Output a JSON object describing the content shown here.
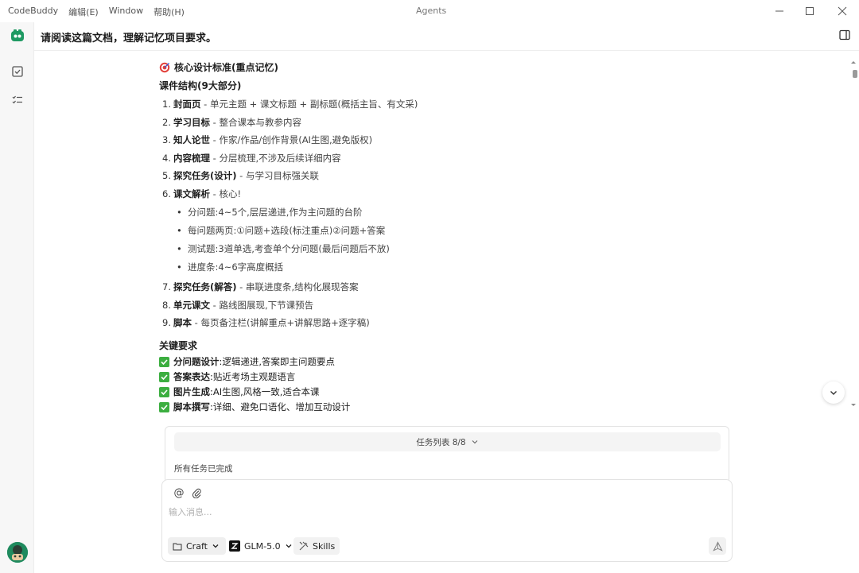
{
  "titlebar": {
    "menu": [
      "CodeBuddy",
      "编辑(E)",
      "Window",
      "帮助(H)"
    ],
    "window_title": "Agents"
  },
  "header": {
    "title": "请阅读这篇文档，理解记忆项目要求。"
  },
  "content": {
    "heading": "核心设计标准(重点记忆)",
    "structure_title": "课件结构(9大部分)",
    "items": [
      {
        "num": "1.",
        "title": "封面页",
        "desc": " - 单元主题 + 课文标题 + 副标题(概括主旨、有文采)"
      },
      {
        "num": "2.",
        "title": "学习目标",
        "desc": " - 整合课本与教参内容"
      },
      {
        "num": "3.",
        "title": "知人论世",
        "desc": " - 作家/作品/创作背景(AI生图,避免版权)"
      },
      {
        "num": "4.",
        "title": "内容梳理",
        "desc": " - 分层梳理,不涉及后续详细内容"
      },
      {
        "num": "5.",
        "title": "探究任务(设计)",
        "desc": " - 与学习目标强关联"
      },
      {
        "num": "6.",
        "title": "课文解析",
        "desc": " - 核心!"
      },
      {
        "num": "7.",
        "title": "探究任务(解答)",
        "desc": " - 串联进度条,结构化展现答案"
      },
      {
        "num": "8.",
        "title": "单元课文",
        "desc": " - 路线图展现,下节课预告"
      },
      {
        "num": "9.",
        "title": "脚本",
        "desc": " - 每页备注栏(讲解重点+讲解思路+逐字稿)"
      }
    ],
    "sub_items": [
      "分问题:4~5个,层层递进,作为主问题的台阶",
      "每问题两页:①问题+选段(标注重点)②问题+答案",
      "测试题:3道单选,考查单个分问题(最后问题后不放)",
      "进度条:4~6字高度概括"
    ],
    "key_title": "关键要求",
    "key_items": [
      {
        "title": "分问题设计",
        "desc": ":逻辑递进,答案即主问题要点"
      },
      {
        "title": "答案表达",
        "desc": ":贴近考场主观题语言"
      },
      {
        "title": "图片生成",
        "desc": ":AI生图,风格一致,适合本课"
      },
      {
        "title": "脚本撰写",
        "desc": ":详细、避免口语化、增加互动设计"
      }
    ]
  },
  "task_list": {
    "label": "任务列表 8/8",
    "status": "所有任务已完成"
  },
  "input": {
    "placeholder": "输入消息...",
    "mode": "Craft",
    "model": "GLM-5.0",
    "skills": "Skills"
  },
  "colors": {
    "check": "#3cae40",
    "brand": "#1f8a5e"
  }
}
